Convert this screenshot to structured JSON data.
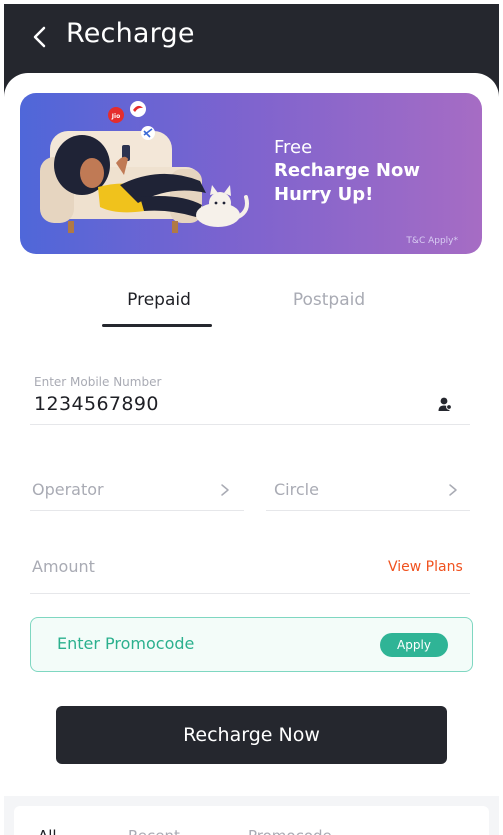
{
  "header": {
    "title": "Recharge",
    "back_icon": "chevron-left-icon"
  },
  "banner": {
    "logos": [
      "Jio",
      "airtel"
    ],
    "line1": "Free",
    "line2": "Recharge Now",
    "line3": "Hurry Up!",
    "terms": "T&C Apply*"
  },
  "tabs": [
    {
      "label": "Prepaid",
      "active": true
    },
    {
      "label": "Postpaid",
      "active": false
    }
  ],
  "form": {
    "mobile_label": "Enter Mobile Number",
    "mobile_value": "1234567890",
    "contact_icon": "contact-person-icon",
    "operator_placeholder": "Operator",
    "circle_placeholder": "Circle",
    "amount_placeholder": "Amount",
    "view_plans": "View Plans",
    "promo_placeholder": "Enter Promocode",
    "apply_label": "Apply"
  },
  "cta": {
    "label": "Recharge Now"
  },
  "bottom_tabs": [
    {
      "label": "All",
      "active": true
    },
    {
      "label": "Recent",
      "active": false
    },
    {
      "label": "Promocode",
      "active": false
    }
  ],
  "colors": {
    "header_bg": "#25272e",
    "accent_orange": "#f0521f",
    "promo_green": "#2fb496",
    "banner_start": "#4f67d9",
    "banner_end": "#a66cc4"
  }
}
